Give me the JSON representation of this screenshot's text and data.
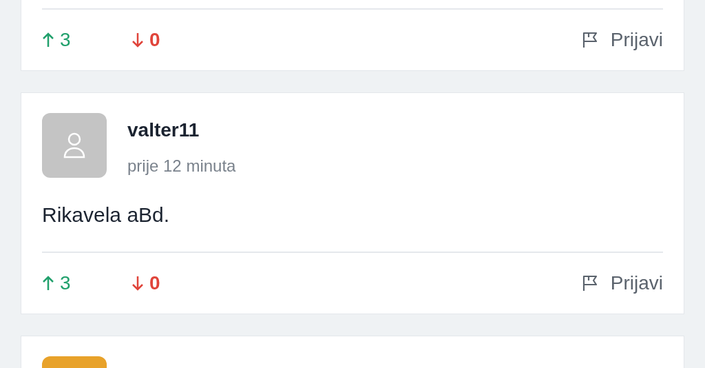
{
  "comments": [
    {
      "upvotes": "3",
      "downvotes": "0",
      "report_label": "Prijavi"
    },
    {
      "color": "#c4c4c4",
      "author": "valter11",
      "time": "prije 12 minuta",
      "text": "Rikavela aBd.",
      "upvotes": "3",
      "downvotes": "0",
      "report_label": "Prijavi"
    },
    {
      "color": "#e8a22a"
    }
  ]
}
